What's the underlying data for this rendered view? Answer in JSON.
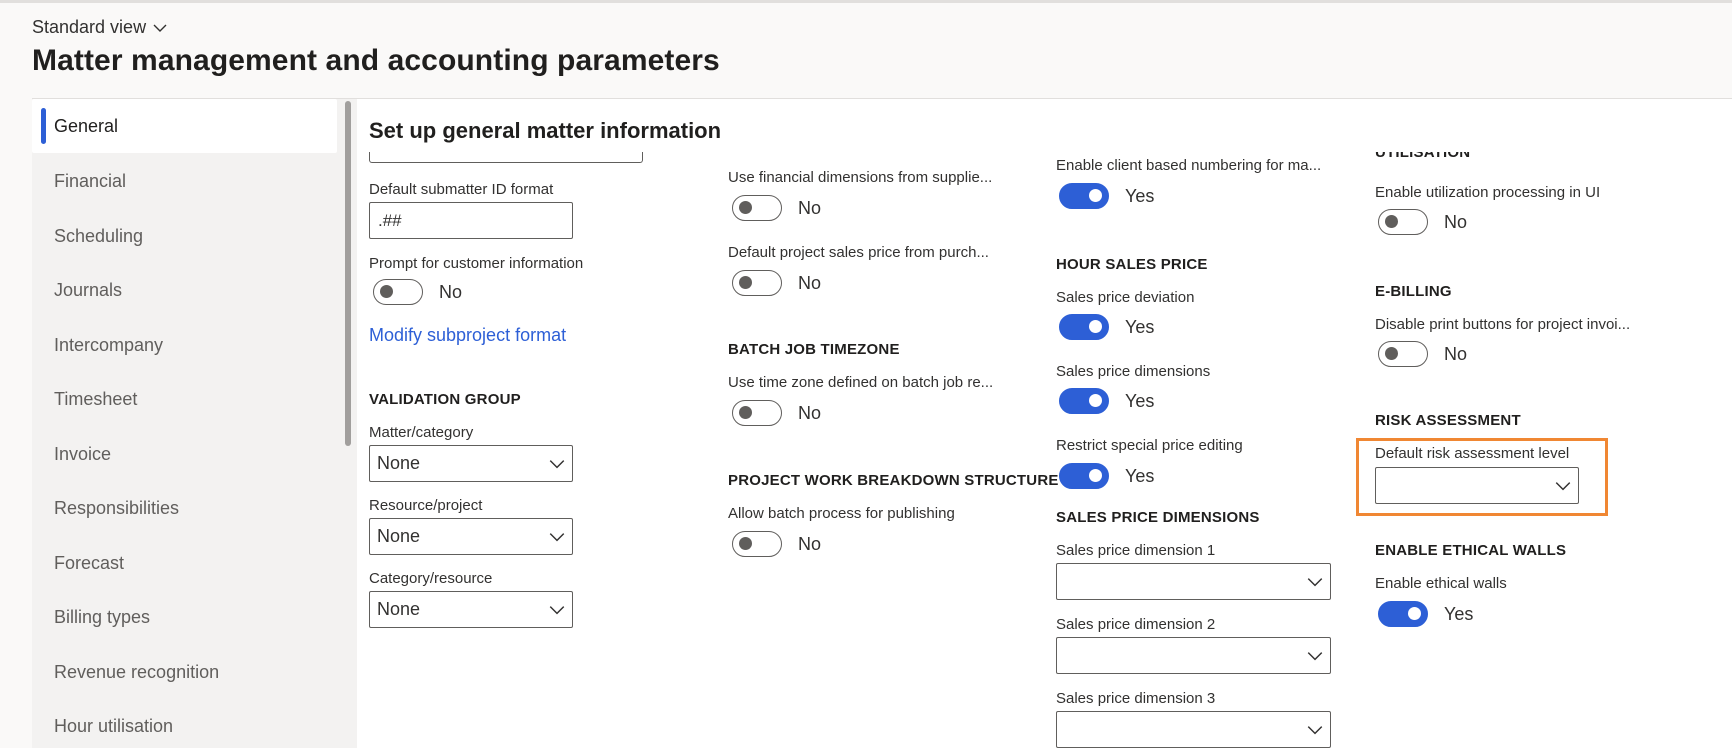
{
  "header": {
    "view_label": "Standard view",
    "page_title": "Matter management and accounting parameters"
  },
  "sidebar": {
    "items": [
      {
        "label": "General",
        "active": true
      },
      {
        "label": "Financial"
      },
      {
        "label": "Scheduling"
      },
      {
        "label": "Journals"
      },
      {
        "label": "Intercompany"
      },
      {
        "label": "Timesheet"
      },
      {
        "label": "Invoice"
      },
      {
        "label": "Responsibilities"
      },
      {
        "label": "Forecast"
      },
      {
        "label": "Billing types"
      },
      {
        "label": "Revenue recognition"
      },
      {
        "label": "Hour utilisation"
      }
    ]
  },
  "main": {
    "section_title": "Set up general matter information",
    "col1": {
      "submatter_label": "Default submatter ID format",
      "submatter_value": ".##",
      "prompt_label": "Prompt for customer information",
      "prompt_value": "No",
      "modify_link": "Modify subproject format",
      "validation_group": "VALIDATION GROUP",
      "matter_category_label": "Matter/category",
      "matter_category_value": "None",
      "resource_project_label": "Resource/project",
      "resource_project_value": "None",
      "category_resource_label": "Category/resource",
      "category_resource_value": "None"
    },
    "col2": {
      "fin_dim_label": "Use financial dimensions from supplie...",
      "fin_dim_value": "No",
      "sales_price_purch_label": "Default project sales price from purch...",
      "sales_price_purch_value": "No",
      "batch_group": "BATCH JOB TIMEZONE",
      "batch_tz_label": "Use time zone defined on batch job re...",
      "batch_tz_value": "No",
      "wbs_group": "PROJECT WORK BREAKDOWN STRUCTURE",
      "batch_publish_label": "Allow batch process for publishing",
      "batch_publish_value": "No"
    },
    "col3": {
      "client_numbering_label": "Enable client based numbering for ma...",
      "client_numbering_value": "Yes",
      "hour_sales_group": "HOUR SALES PRICE",
      "deviation_label": "Sales price deviation",
      "deviation_value": "Yes",
      "dimensions_label": "Sales price dimensions",
      "dimensions_value": "Yes",
      "restrict_label": "Restrict special price editing",
      "restrict_value": "Yes",
      "spd_group": "SALES PRICE DIMENSIONS",
      "spd1_label": "Sales price dimension 1",
      "spd1_value": "",
      "spd2_label": "Sales price dimension 2",
      "spd2_value": "",
      "spd3_label": "Sales price dimension 3",
      "spd3_value": ""
    },
    "col4": {
      "utilisation_group": "UTILISATION",
      "utilization_ui_label": "Enable utilization processing in UI",
      "utilization_ui_value": "No",
      "ebilling_group": "E-BILLING",
      "disable_print_label": "Disable print buttons for project invoi...",
      "disable_print_value": "No",
      "risk_group": "RISK ASSESSMENT",
      "risk_level_label": "Default risk assessment level",
      "risk_level_value": "",
      "ethical_group": "ENABLE ETHICAL WALLS",
      "ethical_label": "Enable ethical walls",
      "ethical_value": "Yes"
    }
  },
  "icons": {
    "dropdown": "chevron-down-icon"
  },
  "colors": {
    "accent": "#2d5fd6",
    "highlight": "#f08733"
  }
}
